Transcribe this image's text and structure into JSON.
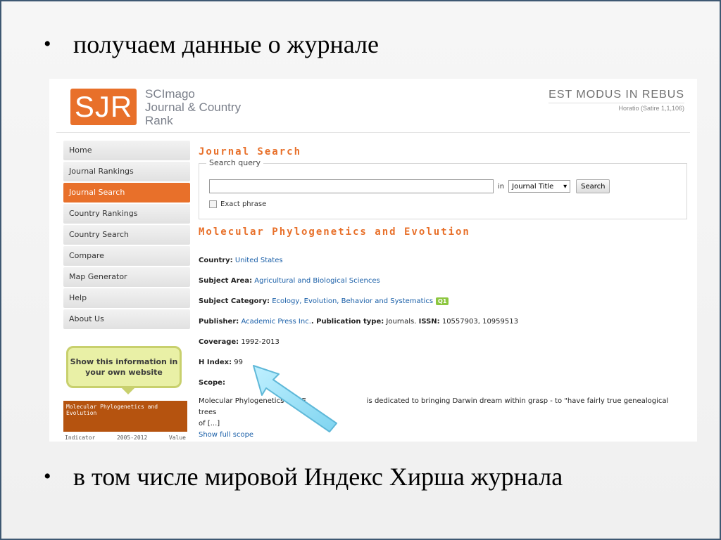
{
  "slide": {
    "bullet1": "получаем данные о журнале",
    "bullet2": "в том числе мировой Индекс Хирша журнала",
    "bullet_glyph": "•"
  },
  "site": {
    "logo": "SJR",
    "logo_line1": "SCImago",
    "logo_line2": "Journal & Country",
    "logo_line3": "Rank",
    "motto": "EST MODUS IN REBUS",
    "motto_sub": "Horatio (Satire 1,1,106)",
    "brand_color": "#e8702a"
  },
  "nav": {
    "items": [
      "Home",
      "Journal Rankings",
      "Journal Search",
      "Country Rankings",
      "Country Search",
      "Compare",
      "Map Generator",
      "Help",
      "About Us"
    ],
    "active": "Journal Search",
    "callout": "Show this information in your own website"
  },
  "widget": {
    "title": "Molecular Phylogenetics and Evolution",
    "col1": "Indicator",
    "col2": "2005-2012",
    "col3": "Value"
  },
  "search": {
    "section_title": "Journal Search",
    "legend": "Search query",
    "input_value": "",
    "in_label": "in",
    "select_value": "Journal Title",
    "button": "Search",
    "exact_phrase": "Exact phrase"
  },
  "journal": {
    "title": "Molecular Phylogenetics and Evolution",
    "country_label": "Country:",
    "country": "United States",
    "subject_area_label": "Subject Area:",
    "subject_area": "Agricultural and Biological Sciences",
    "subject_category_label": "Subject Category:",
    "subject_category": "Ecology, Evolution, Behavior and Systematics",
    "quartile": "Q1",
    "publisher_label": "Publisher:",
    "publisher": "Academic Press Inc.",
    "pubtype_label": ". Publication type:",
    "pubtype": "Journals.",
    "issn_label": "ISSN:",
    "issn": "10557903, 10959513",
    "coverage_label": "Coverage:",
    "coverage": "1992-2013",
    "hindex_label": "H Index:",
    "hindex": "99",
    "scope_label": "Scope:",
    "scope_start": "Molecular Phylogenetics and E",
    "scope_end": "is dedicated to bringing Darwin dream within grasp - to \"have fairly true genealogical trees",
    "scope_more": "of [...]",
    "show_full_scope": "Show full scope"
  }
}
